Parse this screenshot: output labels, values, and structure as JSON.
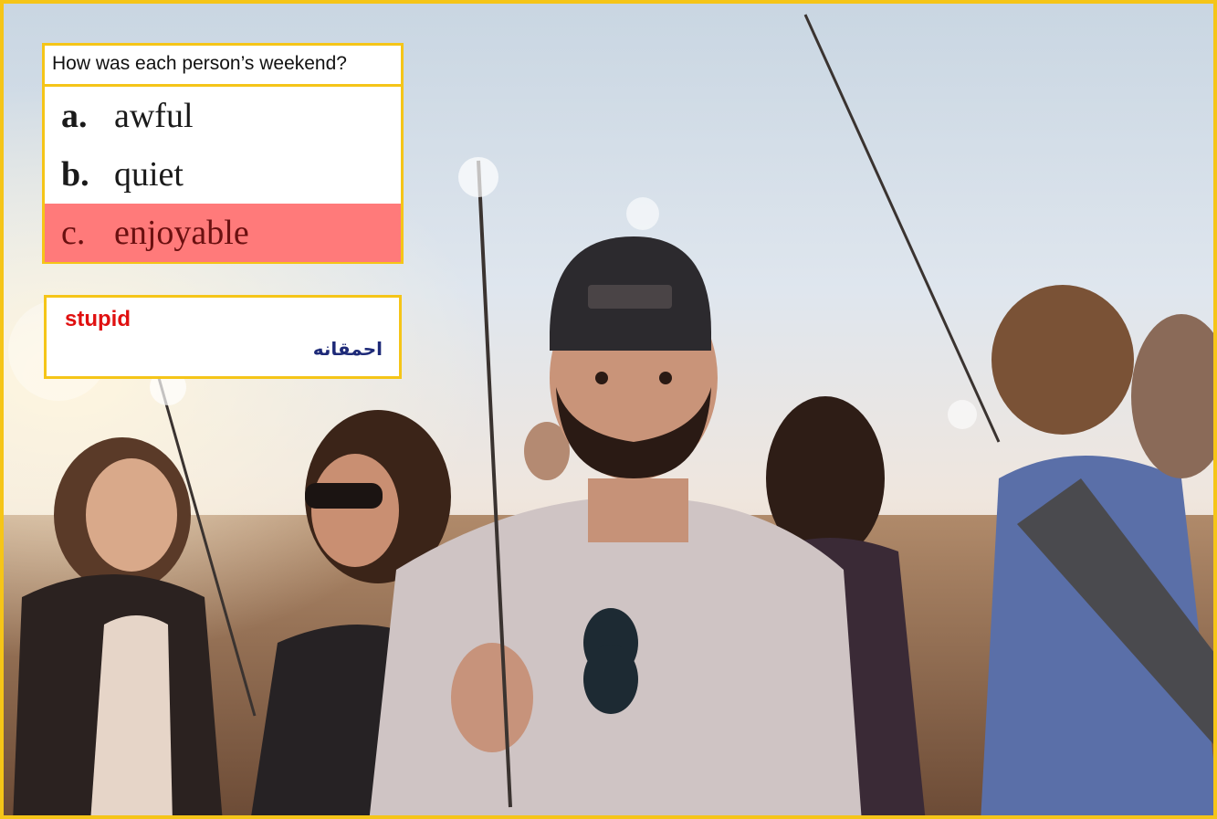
{
  "question": {
    "title": "How was each person’s weekend?",
    "options": [
      {
        "letter": "a.",
        "word": "awful"
      },
      {
        "letter": "b.",
        "word": "quiet"
      },
      {
        "letter": "c.",
        "word": "enjoyable",
        "highlighted": true
      }
    ]
  },
  "vocab": {
    "english": "stupid",
    "persian": "احمقانه"
  },
  "colors": {
    "frame": "#f5c518",
    "highlight": "#ff7a7a",
    "vocab_english": "#e01010",
    "vocab_persian": "#1e2a78"
  }
}
